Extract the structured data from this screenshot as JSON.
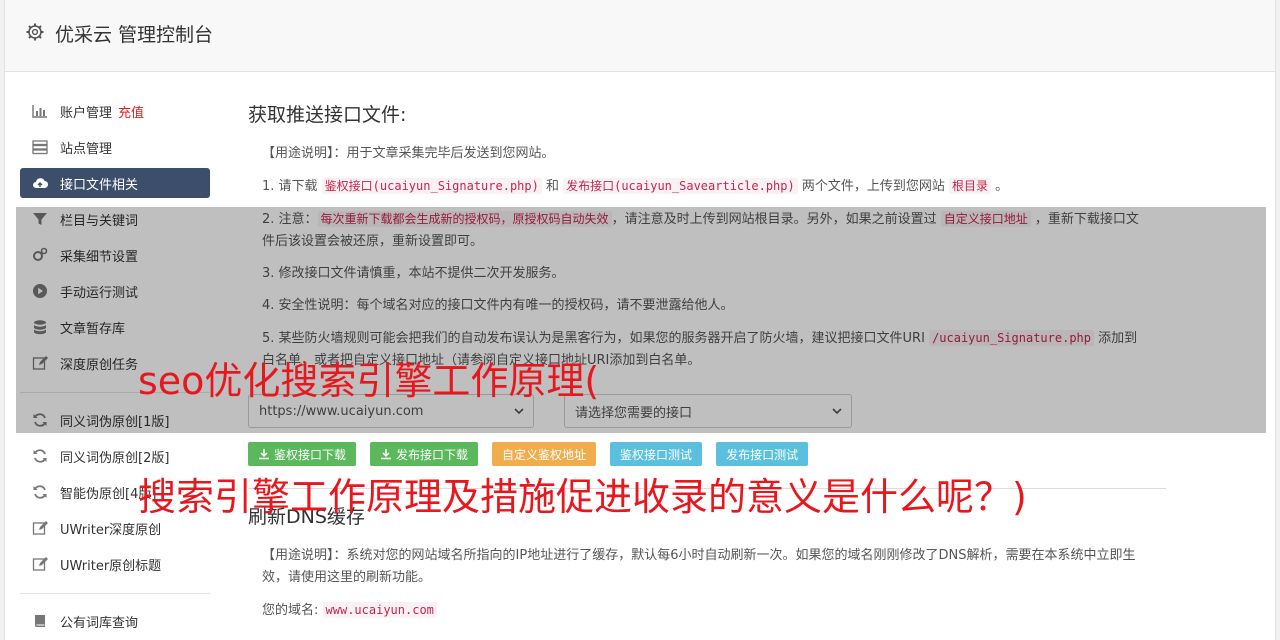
{
  "header": {
    "title": "优采云 管理控制台"
  },
  "sidebar": {
    "recharge": "充值",
    "items": [
      {
        "label": "账户管理",
        "icon": "bar-chart-icon"
      },
      {
        "label": "站点管理",
        "icon": "server-icon"
      },
      {
        "label": "接口文件相关",
        "icon": "cloud-upload-icon",
        "active": true
      },
      {
        "label": "栏目与关键词",
        "icon": "filter-icon"
      },
      {
        "label": "采集细节设置",
        "icon": "cogs-icon"
      },
      {
        "label": "手动运行测试",
        "icon": "play-circle-icon"
      },
      {
        "label": "文章暂存库",
        "icon": "database-icon"
      },
      {
        "label": "深度原创任务",
        "icon": "edit-icon"
      }
    ],
    "items2": [
      {
        "label": "同义词伪原创[1版]",
        "icon": "refresh-icon"
      },
      {
        "label": "同义词伪原创[2版]",
        "icon": "refresh-icon"
      },
      {
        "label": "智能伪原创[4版]",
        "icon": "refresh-icon"
      },
      {
        "label": "UWriter深度原创",
        "icon": "edit-icon"
      },
      {
        "label": "UWriter原创标题",
        "icon": "edit-icon"
      }
    ],
    "items3": [
      {
        "label": "公有词库查询",
        "icon": "book-icon"
      }
    ]
  },
  "content": {
    "section1_title": "获取推送接口文件:",
    "usage_label": "【用途说明】",
    "usage1": "：用于文章采集完毕后发送到您网站。",
    "s1_prefix": "1. 请下载 ",
    "s1_code1": "鉴权接口(ucaiyun_Signature.php)",
    "s1_and": " 和 ",
    "s1_code2": "发布接口(ucaiyun_Savearticle.php)",
    "s1_mid": " 两个文件，上传到您网站 ",
    "s1_code3": "根目录",
    "s1_end": " 。",
    "s2_prefix": "2. 注意：",
    "s2_code1": "每次重新下载都会生成新的授权码，原授权码自动失效",
    "s2_mid": "，请注意及时上传到网站根目录。另外，如果之前设置过 ",
    "s2_code2": "自定义接口地址",
    "s2_end": " ，重新下载接口文件后该设置会被还原，重新设置即可。",
    "s3": "3. 修改接口文件请慎重，本站不提供二次开发服务。",
    "s4": "4. 安全性说明：每个域名对应的接口文件内有唯一的授权码，请不要泄露给他人。",
    "s5_prefix": "5. 某些防火墙规则可能会把我们的自动发布误认为是黑客行为，如果您的服务器开启了防火墙，建议把接口文件URI ",
    "s5_code": "/ucaiyun_Signature.php",
    "s5_end": " 添加到白名单，或者把自定义接口地址（请参阅自定义接口地址URI添加到白名单。",
    "select_site": "https://www.ucaiyun.com",
    "select_api": "请选择您需要的接口",
    "buttons": {
      "b1": "鉴权接口下载",
      "b2": "发布接口下载",
      "b3": "自定义鉴权地址",
      "b4": "鉴权接口测试",
      "b5": "发布接口测试"
    },
    "section2_title": "刷新DNS缓存",
    "usage2": "：系统对您的网站域名所指向的IP地址进行了缓存，默认每6小时自动刷新一次。如果您的域名刚刚修改了DNS解析，需要在本系统中立即生效，请使用这里的刷新功能。",
    "domain_label": "您的域名:",
    "domain_value": "www.ucaiyun.com"
  },
  "overlay": {
    "line1": "seo优化搜索引擎工作原理(",
    "line2": "搜索引擎工作原理及措施促进收录的意义是什么呢？)"
  }
}
